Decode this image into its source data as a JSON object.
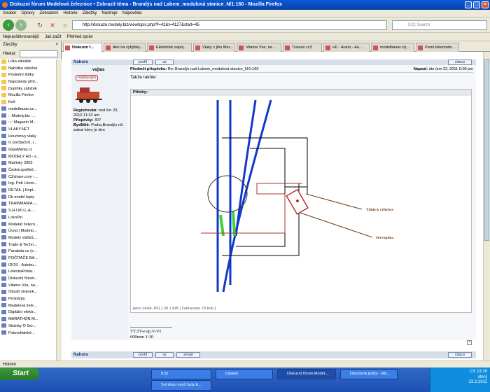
{
  "window": {
    "title": "Diskuzní fórum Modelová železnice • Zobrazit téma - Brandýs nad Labem_modulová stanice_N/1:160 - Mozilla Firefox"
  },
  "menu": [
    "Soubor",
    "Úpravy",
    "Zobrazení",
    "Historie",
    "Záložky",
    "Nástroje",
    "Nápověda"
  ],
  "nav": {
    "url": "http://diskuze.modely.biz/viewtopic.php?f=42&t=4127&start=45",
    "search_placeholder": "ICQ Search"
  },
  "bookmarks_bar": [
    "Nejnavštěvovanější",
    "Jak začít",
    "Přehled zpráv"
  ],
  "sidebar": {
    "title": "Záložky",
    "search_label": "Hledat:",
    "items": [
      "Lišta záložek",
      "Nabídka záložek",
      "Poslední štítky",
      "Naposledy příd...",
      "Doplňky záložek",
      "Mozilla Firefox",
      "Koš",
      "modelbazar.cz...",
      ":: Modely.biz -...",
      ":::: Magazín M...",
      "VLAKY.NET",
      "Houmrovy vlaky",
      "O počítačích, I...",
      "GigaMania.cz",
      "MODELY H0 - s...",
      "Mašinky 2003",
      "Česká spořitel...",
      "CZshare.com -...",
      "Ing. Petr Litom...",
      "DETAIL | Dopl...",
      "Dk model lepty",
      "TRAINMANIA -...",
      "S.H.I.M.I.L.A....",
      "LokoPin",
      "Modelář železn...",
      "Úvod | Modelo...",
      "Modely vláčků,...",
      "Trade & Techn...",
      "Parabola.cz (s...",
      "POČÍTAČE BA...",
      "IDOS - Autobu...",
      "LeteckaPosta...",
      "Diskuzní fórum...",
      "Vitame Vás, na...",
      "Obsah stránek...",
      "Prototypy",
      "Modelová žele...",
      "Digitální elektr...",
      "MARATHON M...",
      "Stránky O Ser...",
      "Fotovoltaické..."
    ]
  },
  "tabs": [
    "Diskuzní f...",
    "Ako na vyhýbky...",
    "Elektrické zapoj...",
    "Vlaky z jihu Mor...",
    "Vitame Vás, na ...",
    "Travian cz3",
    "H0 - Aukro - Au...",
    "modelbazar.cz|...",
    "Parní lokomotiv..."
  ],
  "post": {
    "top_label": "Nahoru",
    "profile_btn": "profil",
    "pm_btn": "sz",
    "quote_btn": "citace",
    "author": "vojtas",
    "rank": "nepřipojen",
    "subject_label": "Předmět příspěvku:",
    "subject": "Re: Brandýs nad Labem_modulová stanice_N/1:160",
    "posted_label": "Napsal:",
    "posted": "úte úno 22, 2011 6:00 pm",
    "text": "Takže takhle:",
    "attach_label": "Přílohy:",
    "registered_label": "Registrován:",
    "registered": "ned čer 20, 2010 11:32 am",
    "posts_label": "Příspěvky:",
    "posts": "307",
    "location_label": "Bydliště:",
    "location": "Praha,Brandýs n/L zalezi ktery je den",
    "caption": "peco vexle.JPG [ 30.1 KiB | Zobrazeno 23 krát ]",
    "sig1": "TT,TT-e ep.V-VI",
    "sig2": "600mm 1:10",
    "bottom_label": "Nahoru",
    "email_btn": "email"
  },
  "diagram": {
    "label_a": "Táhlo k výhybce",
    "label_b": "Servopáka"
  },
  "status": "Hotovo",
  "taskbar": {
    "start": "Start",
    "items": [
      "ICQ",
      "Cipisek",
      "Diskuzní fórum Model...",
      "Doručená pošta - Mic...",
      "Set dvou vozů řady E..."
    ],
    "lang": "CS",
    "time": "19:16",
    "day": "úterý",
    "date": "22.2.2011"
  }
}
